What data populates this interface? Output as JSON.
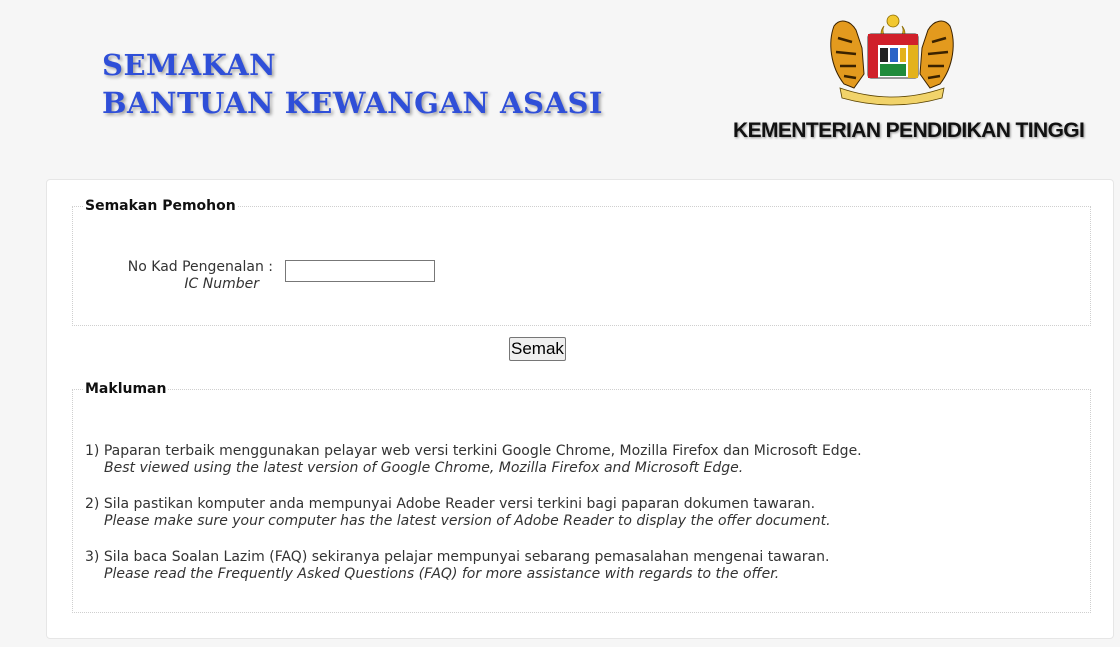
{
  "header": {
    "title_line1": "SEMAKAN",
    "title_line2": "BANTUAN KEWANGAN ASASI",
    "ministry": "KEMENTERIAN PENDIDIKAN TINGGI"
  },
  "form": {
    "legend": "Semakan Pemohon",
    "ic_label": "No Kad Pengenalan :",
    "ic_label_en": "IC Number",
    "ic_value": "",
    "submit_label": "Semak"
  },
  "info": {
    "legend": "Makluman",
    "items": [
      {
        "text": "1) Paparan terbaik menggunakan pelayar web versi terkini Google Chrome, Mozilla Firefox dan Microsoft Edge.",
        "en": "Best viewed using the latest version of Google Chrome, Mozilla Firefox and Microsoft Edge."
      },
      {
        "text": "2) Sila pastikan komputer anda mempunyai Adobe Reader versi terkini bagi paparan dokumen tawaran.",
        "en": "Please make sure your computer has the latest version of Adobe Reader to display the offer document."
      },
      {
        "text": "3) Sila baca Soalan Lazim (FAQ) sekiranya pelajar mempunyai sebarang pemasalahan mengenai tawaran.",
        "en": "Please read the Frequently Asked Questions (FAQ) for more assistance with regards to the offer."
      }
    ]
  },
  "colors": {
    "title_blue": "#2f4fd8",
    "crest_gold": "#e3b21c",
    "crest_red": "#d0202a"
  },
  "icons": {
    "crest": "malaysia-coat-of-arms-icon"
  }
}
